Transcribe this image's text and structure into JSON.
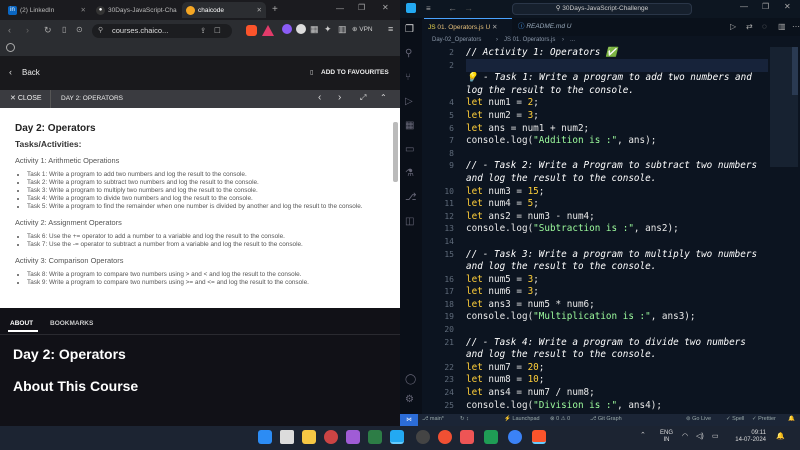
{
  "browser": {
    "tabs": [
      {
        "label": "(2) LinkedIn",
        "icon": "linkedin-icon",
        "color": "#0a66c2"
      },
      {
        "label": "30Days-JavaScript-Cha",
        "icon": "github-icon",
        "color": "#ffffff"
      },
      {
        "label": "chaicode",
        "icon": "chaicode-icon",
        "color": "#f5a623"
      }
    ],
    "url": "courses.chaico...",
    "vpn": "VPN"
  },
  "course": {
    "back": "Back",
    "add_fav": "ADD TO FAVOURITES",
    "close": "CLOSE",
    "lesson": "DAY 2: OPERATORS"
  },
  "doc": {
    "title": "Day 2: Operators",
    "subtitle": "Tasks/Activities:",
    "sections": [
      {
        "heading": "Activity 1: Arithmetic Operations",
        "items": [
          "Task 1: Write a program to add two numbers and log the result to the console.",
          "Task 2: Write a program to subtract two numbers and log the result to the console.",
          "Task 3: Write a program to multiply two numbers and log the result to the console.",
          "Task 4: Write a program to divide two numbers and log the result to the console.",
          "Task 5: Write a program to find the remainder when one number is divided by another and log the result to the console."
        ]
      },
      {
        "heading": "Activity 2: Assignment Operators",
        "items": [
          "Task 6: Use the += operator to add a number to a variable and log the result to the console.",
          "Task 7: Use the -= operator to subtract a number from a variable and log the result to the console."
        ]
      },
      {
        "heading": "Activity 3: Comparison Operators",
        "items": [
          "Task 8: Write a program to compare two numbers using > and < and log the result to the console.",
          "Task 9: Write a program to compare two numbers using >= and <= and log the result to the console."
        ]
      }
    ]
  },
  "bottom": {
    "tab_about": "ABOUT",
    "tab_bookmarks": "BOOKMARKS",
    "heading": "Day 2: Operators",
    "about": "About This Course"
  },
  "editor": {
    "window_title": "30Days-JavaScript-Challenge",
    "tabs": [
      "01. Operators.js U",
      "README.md U"
    ],
    "breadcrumb": [
      "Day-02_Operators",
      "JS 01. Operators.js",
      "..."
    ],
    "lines": [
      {
        "n": "2",
        "t": [
          [
            "cm",
            "// Activity 1: Operators ✅"
          ]
        ]
      },
      {
        "n": "2",
        "t": [
          [
            "",
            ""
          ]
        ]
      },
      {
        "n": "",
        "t": [
          [
            "cm",
            "💡 - Task 1: Write a program to add two numbers and"
          ]
        ]
      },
      {
        "n": "",
        "t": [
          [
            "cm",
            "log the result to the console."
          ]
        ]
      },
      {
        "n": "4",
        "t": [
          [
            "kw",
            "let"
          ],
          [
            "",
            " num1 = "
          ],
          [
            "num",
            "2"
          ],
          [
            "",
            ";"
          ]
        ]
      },
      {
        "n": "5",
        "t": [
          [
            "kw",
            "let"
          ],
          [
            "",
            " num2 = "
          ],
          [
            "num",
            "3"
          ],
          [
            "",
            ";"
          ]
        ]
      },
      {
        "n": "6",
        "t": [
          [
            "kw",
            "let"
          ],
          [
            "",
            " ans = num1 + num2;"
          ]
        ]
      },
      {
        "n": "7",
        "t": [
          [
            "",
            "console.log("
          ],
          [
            "str",
            "\"Addition is :\""
          ],
          [
            "",
            ", ans);"
          ]
        ]
      },
      {
        "n": "8",
        "t": [
          [
            "",
            ""
          ]
        ]
      },
      {
        "n": "9",
        "t": [
          [
            "cm",
            "// - Task 2: Write a Program to subtract two numbers"
          ]
        ]
      },
      {
        "n": "",
        "t": [
          [
            "cm",
            "and log the result to the console."
          ]
        ]
      },
      {
        "n": "10",
        "t": [
          [
            "kw",
            "let"
          ],
          [
            "",
            " num3 = "
          ],
          [
            "num",
            "15"
          ],
          [
            "",
            ";"
          ]
        ]
      },
      {
        "n": "11",
        "t": [
          [
            "kw",
            "let"
          ],
          [
            "",
            " num4 = "
          ],
          [
            "num",
            "5"
          ],
          [
            "",
            ";"
          ]
        ]
      },
      {
        "n": "12",
        "t": [
          [
            "kw",
            "let"
          ],
          [
            "",
            " ans2 = num3 - num4;"
          ]
        ]
      },
      {
        "n": "13",
        "t": [
          [
            "",
            "console.log("
          ],
          [
            "str",
            "\"Subtraction is :\""
          ],
          [
            "",
            ", ans2);"
          ]
        ]
      },
      {
        "n": "14",
        "t": [
          [
            "",
            ""
          ]
        ]
      },
      {
        "n": "15",
        "t": [
          [
            "cm",
            "// - Task 3: Write a program to multiply two numbers"
          ]
        ]
      },
      {
        "n": "",
        "t": [
          [
            "cm",
            "and log the result to the console."
          ]
        ]
      },
      {
        "n": "16",
        "t": [
          [
            "kw",
            "let"
          ],
          [
            "",
            " num5 = "
          ],
          [
            "num",
            "3"
          ],
          [
            "",
            ";"
          ]
        ]
      },
      {
        "n": "17",
        "t": [
          [
            "kw",
            "let"
          ],
          [
            "",
            " num6 = "
          ],
          [
            "num",
            "3"
          ],
          [
            "",
            ";"
          ]
        ]
      },
      {
        "n": "18",
        "t": [
          [
            "kw",
            "let"
          ],
          [
            "",
            " ans3 = num5 * num6;"
          ]
        ]
      },
      {
        "n": "19",
        "t": [
          [
            "",
            "console.log("
          ],
          [
            "str",
            "\"Multiplication is :\""
          ],
          [
            "",
            ", ans3);"
          ]
        ]
      },
      {
        "n": "20",
        "t": [
          [
            "",
            ""
          ]
        ]
      },
      {
        "n": "21",
        "t": [
          [
            "cm",
            "// - Task 4: Write a program to divide two numbers"
          ]
        ]
      },
      {
        "n": "",
        "t": [
          [
            "cm",
            "and log the result to the console."
          ]
        ]
      },
      {
        "n": "22",
        "t": [
          [
            "kw",
            "let"
          ],
          [
            "",
            " num7 = "
          ],
          [
            "num",
            "20"
          ],
          [
            "",
            ";"
          ]
        ]
      },
      {
        "n": "23",
        "t": [
          [
            "kw",
            "let"
          ],
          [
            "",
            " num8 = "
          ],
          [
            "num",
            "10"
          ],
          [
            "",
            ";"
          ]
        ]
      },
      {
        "n": "24",
        "t": [
          [
            "kw",
            "let"
          ],
          [
            "",
            " ans4 = num7 / num8;"
          ]
        ]
      },
      {
        "n": "25",
        "t": [
          [
            "",
            "console.log("
          ],
          [
            "str",
            "\"Division is :\""
          ],
          [
            "",
            ", ans4);"
          ]
        ]
      }
    ],
    "status": {
      "branch": "main*",
      "errors": "⊗ 0 ⚠ 0",
      "git": "Git Graph",
      "launchpad": "Launchpad",
      "golive": "Go Live",
      "spell": "Spell",
      "prettier": "Prettier"
    }
  },
  "taskbar": {
    "lang": "ENG",
    "region": "IN",
    "time": "09:11",
    "date": "14-07-2024"
  }
}
